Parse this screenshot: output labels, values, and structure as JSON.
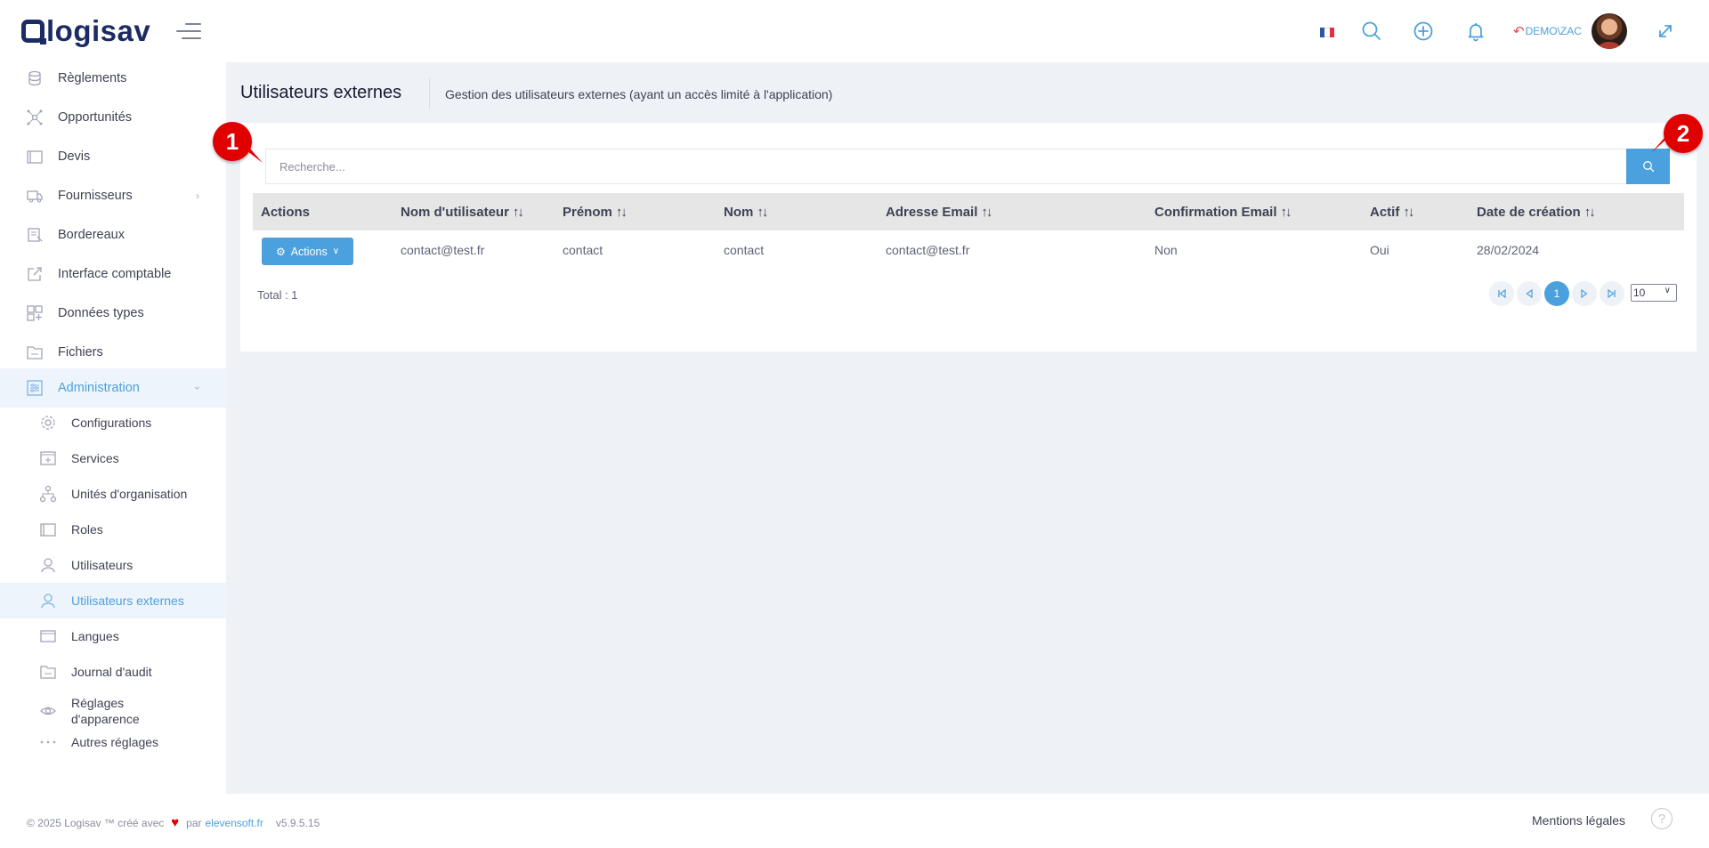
{
  "header": {
    "logo": "logisav",
    "user": "DEMO\\ZAC"
  },
  "sidebar": {
    "items": [
      {
        "label": "Règlements",
        "icon": "coins-icon"
      },
      {
        "label": "Opportunités",
        "icon": "network-icon"
      },
      {
        "label": "Devis",
        "icon": "folder-icon"
      },
      {
        "label": "Fournisseurs",
        "icon": "truck-icon"
      },
      {
        "label": "Bordereaux",
        "icon": "document-icon"
      },
      {
        "label": "Interface comptable",
        "icon": "external-link-icon"
      },
      {
        "label": "Données types",
        "icon": "grid-icon"
      },
      {
        "label": "Fichiers",
        "icon": "folder-icon"
      },
      {
        "label": "Administration",
        "icon": "admin-icon"
      }
    ],
    "subitems": [
      {
        "label": "Configurations",
        "icon": "gear-icon"
      },
      {
        "label": "Services",
        "icon": "services-icon"
      },
      {
        "label": "Unités d'organisation",
        "icon": "org-icon"
      },
      {
        "label": "Roles",
        "icon": "folder-icon"
      },
      {
        "label": "Utilisateurs",
        "icon": "user-icon"
      },
      {
        "label": "Utilisateurs externes",
        "icon": "user-icon"
      },
      {
        "label": "Langues",
        "icon": "language-icon"
      },
      {
        "label": "Journal d'audit",
        "icon": "journal-icon"
      },
      {
        "label": "Réglages d'apparence",
        "icon": "eye-icon"
      },
      {
        "label": "Autres réglages",
        "icon": "dots-icon"
      }
    ]
  },
  "page": {
    "title": "Utilisateurs externes",
    "subtitle": "Gestion des utilisateurs externes (ayant un accès limité à l'application)"
  },
  "search": {
    "placeholder": "Recherche..."
  },
  "table": {
    "columns": [
      "Actions",
      "Nom d'utilisateur",
      "Prénom",
      "Nom",
      "Adresse Email",
      "Confirmation Email",
      "Actif",
      "Date de création"
    ],
    "rows": [
      {
        "actions": "Actions",
        "username": "contact@test.fr",
        "firstname": "contact",
        "lastname": "contact",
        "email": "contact@test.fr",
        "email_confirmed": "Non",
        "active": "Oui",
        "created": "28/02/2024"
      }
    ]
  },
  "pagination": {
    "total": "Total : 1",
    "current_page": "1",
    "page_size": "10"
  },
  "callouts": [
    "1",
    "2"
  ],
  "footer": {
    "copyright": "© 2025 Logisav ™ créé avec",
    "by": "par",
    "link": "elevensoft.fr",
    "version": "v5.9.5.15",
    "mentions": "Mentions légales",
    "help": "?"
  },
  "colors": {
    "accent": "#4ba1de",
    "brand": "#1c2b64",
    "callout": "#e10000"
  }
}
